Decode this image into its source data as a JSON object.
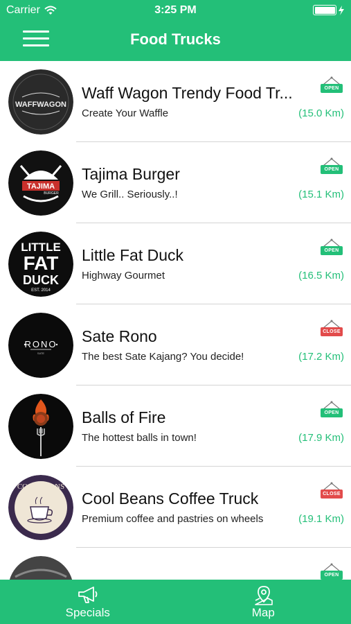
{
  "status_bar": {
    "carrier": "Carrier",
    "time": "3:25 PM"
  },
  "nav": {
    "title": "Food Trucks",
    "menu_icon": "hamburger-menu-icon"
  },
  "colors": {
    "brand_green": "#23bf78",
    "close_red": "#e24b4b"
  },
  "trucks": [
    {
      "name": "Waff Wagon Trendy Food Tr...",
      "tagline": "Create Your Waffle",
      "distance": "(15.0 Km)",
      "status": "OPEN",
      "logo_text": [
        "WAFFWAGON"
      ]
    },
    {
      "name": "Tajima Burger",
      "tagline": "We Grill.. Seriously..!",
      "distance": "(15.1 Km)",
      "status": "OPEN",
      "logo_text": [
        "TAJIMA",
        "BURGER"
      ]
    },
    {
      "name": "Little Fat Duck",
      "tagline": "Highway Gourmet",
      "distance": "(16.5 Km)",
      "status": "OPEN",
      "logo_text": [
        "LITTLE",
        "FAT",
        "DUCK",
        "EST. 2014"
      ]
    },
    {
      "name": "Sate Rono",
      "tagline": "The best Sate Kajang? You decide!",
      "distance": "(17.2 Km)",
      "status": "CLOSE",
      "logo_text": [
        "RONO",
        "SATE"
      ]
    },
    {
      "name": "Balls of Fire",
      "tagline": "The hottest balls in town!",
      "distance": "(17.9 Km)",
      "status": "OPEN",
      "logo_text": []
    },
    {
      "name": "Cool Beans Coffee Truck",
      "tagline": "Premium coffee and pastries on wheels",
      "distance": "(19.1 Km)",
      "status": "CLOSE",
      "logo_text": [
        "COOL BEANS"
      ]
    },
    {
      "name": "",
      "tagline": "",
      "distance": "",
      "status": "OPEN",
      "logo_text": []
    }
  ],
  "tabbar": {
    "tabs": [
      {
        "label": "Specials",
        "icon": "megaphone-icon"
      },
      {
        "label": "Map",
        "icon": "map-pin-icon"
      }
    ]
  }
}
